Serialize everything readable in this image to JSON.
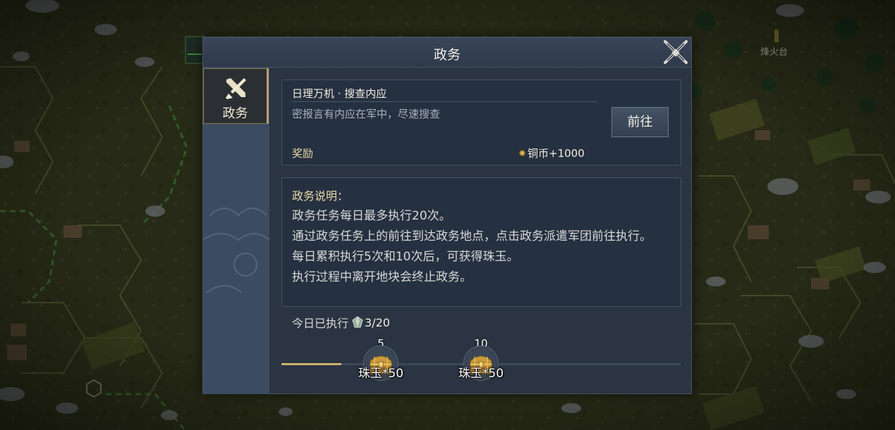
{
  "map": {
    "place_label": "烽火台"
  },
  "dialog": {
    "title": "政务",
    "close_icon": "close-crossed-swords-icon"
  },
  "sidebar": {
    "tabs": [
      {
        "label": "政务",
        "icon": "affairs-brush-scroll-icon",
        "selected": true
      }
    ]
  },
  "task": {
    "title": "日理万机 · 搜查内应",
    "description": "密报言有内应在军中，尽速搜查",
    "go_button": "前往",
    "reward_label": "奖励",
    "reward_value": "铜币+1000",
    "reward_icon": "copper-coin-icon"
  },
  "description": {
    "heading": "政务说明：",
    "lines": [
      "政务任务每日最多执行20次。",
      "通过政务任务上的前往到达政务地点，点击政务派遣军团前往执行。",
      "每日累积执行5次和10次后，可获得珠玉。",
      "执行过程中离开地块会终止政务。"
    ]
  },
  "progress": {
    "today_label": "今日已执行",
    "today_icon": "gem-icon",
    "today_count": "3/20",
    "done": 3,
    "max": 20,
    "milestones": [
      {
        "threshold": "5",
        "reward": "珠玉*50",
        "icon": "treasure-chest-icon"
      },
      {
        "threshold": "10",
        "reward": "珠玉*50",
        "icon": "treasure-chest-icon"
      }
    ]
  },
  "colors": {
    "accent_gold": "#e9d9a8",
    "panel": "#253040",
    "progress_fill": "#d4bb78"
  }
}
